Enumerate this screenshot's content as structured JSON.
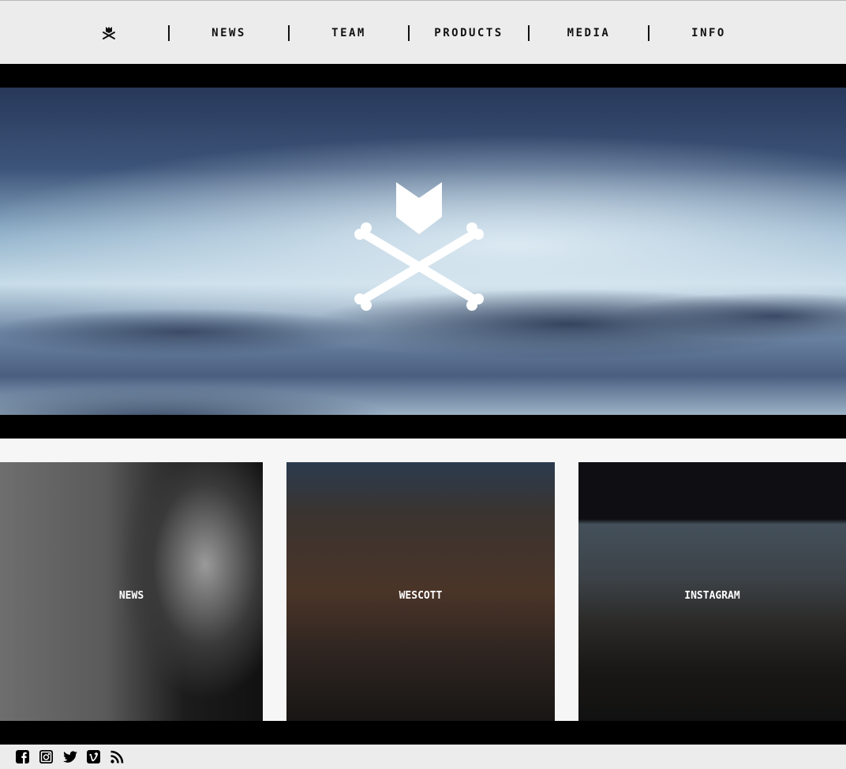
{
  "nav": {
    "logo": "skull-crossbones-logo",
    "items": [
      {
        "label": "NEWS"
      },
      {
        "label": "TEAM"
      },
      {
        "label": "PRODUCTS"
      },
      {
        "label": "MEDIA"
      },
      {
        "label": "INFO"
      }
    ]
  },
  "hero": {
    "logo": "crossbones-shield-logo"
  },
  "tiles": [
    {
      "label": "NEWS"
    },
    {
      "label": "WESCOTT"
    },
    {
      "label": "INSTAGRAM"
    }
  ],
  "footer": {
    "icons": [
      "facebook-icon",
      "instagram-icon",
      "twitter-icon",
      "vimeo-icon",
      "rss-icon"
    ]
  }
}
